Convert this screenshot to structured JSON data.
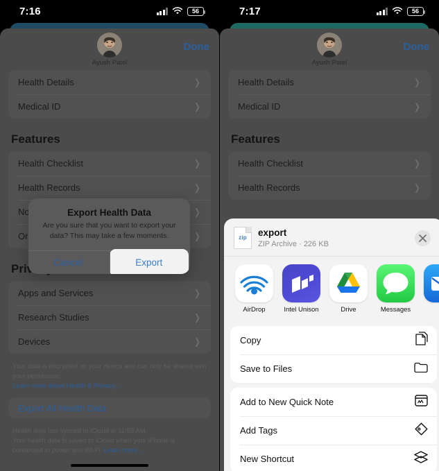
{
  "colors": {
    "accent_blue": "#2b5f9e",
    "teal_card": "#1f5f63",
    "blue_card": "#1f4a63",
    "dim_bg": "#4b4b4b",
    "share_bg": "#f3f3f3"
  },
  "left": {
    "status": {
      "time": "7:16",
      "battery": "56",
      "signal_icon": "cellular-bars-icon",
      "wifi_icon": "wifi-icon"
    },
    "header": {
      "name": "Ayush Patel",
      "done_label": "Done"
    },
    "groups": [
      {
        "rows": [
          "Health Details",
          "Medical ID"
        ]
      }
    ],
    "features_title": "Features",
    "feature_rows": [
      "Health Checklist",
      "Health Records",
      "Notifications",
      "Organ Donation"
    ],
    "privacy_title": "Privacy",
    "privacy_rows": [
      "Apps and Services",
      "Research Studies",
      "Devices"
    ],
    "privacy_footer": "Your data is encrypted on your device and can only be shared with your permission.",
    "privacy_footer_link": "Learn more about Health & Privacy...",
    "export_all_label": "Export All Health Data",
    "sync_footer_line1": "Health data last synced to iCloud at 11:53 AM.",
    "sync_footer_line2": "Your health data is saved to iCloud when your iPhone is connected to power and Wi-Fi.",
    "sync_footer_link": "Learn more...",
    "alert": {
      "title": "Export Health Data",
      "message": "Are you sure that you want to export your data? This may take a few moments.",
      "cancel_label": "Cancel",
      "confirm_label": "Export"
    }
  },
  "right": {
    "status": {
      "time": "7:17",
      "battery": "56",
      "signal_icon": "cellular-bars-icon",
      "wifi_icon": "wifi-icon"
    },
    "header": {
      "name": "Ayush Patel",
      "done_label": "Done"
    },
    "groups": [
      {
        "rows": [
          "Health Details",
          "Medical ID"
        ]
      }
    ],
    "features_title": "Features",
    "feature_rows": [
      "Health Checklist",
      "Health Records"
    ],
    "share_sheet": {
      "file_name": "export",
      "file_meta": "ZIP Archive · 226 KB",
      "file_type_badge": "zip",
      "close_icon": "close-icon",
      "apps": [
        {
          "label": "AirDrop",
          "icon": "airdrop-icon"
        },
        {
          "label": "Intel Unison",
          "icon": "intel-unison-icon"
        },
        {
          "label": "Drive",
          "icon": "google-drive-icon"
        },
        {
          "label": "Messages",
          "icon": "messages-icon"
        },
        {
          "label": "",
          "icon": "mail-icon"
        }
      ],
      "actions_group_1": [
        {
          "label": "Copy",
          "icon": "copy-icon"
        },
        {
          "label": "Save to Files",
          "icon": "folder-icon"
        }
      ],
      "actions_group_2": [
        {
          "label": "Add to New Quick Note",
          "icon": "quick-note-icon"
        },
        {
          "label": "Add Tags",
          "icon": "tag-icon"
        },
        {
          "label": "New Shortcut",
          "icon": "shortcuts-icon"
        }
      ]
    }
  }
}
